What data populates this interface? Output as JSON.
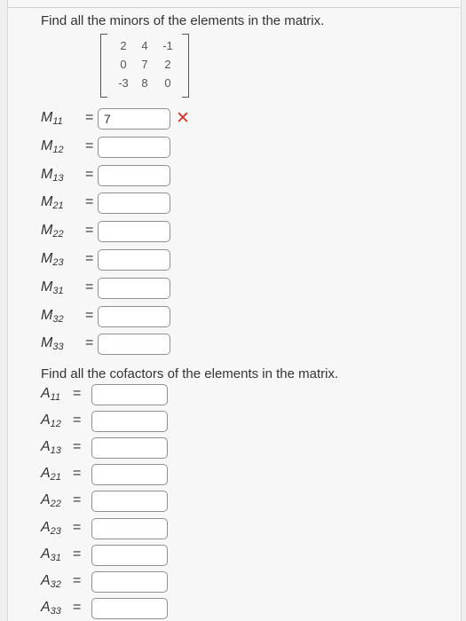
{
  "minors_prompt": "Find all the minors of the elements in the matrix.",
  "cofactors_prompt": "Find all the cofactors of the elements in the matrix.",
  "matrix": [
    [
      "2",
      "4",
      "-1"
    ],
    [
      "0",
      "7",
      "2"
    ],
    [
      "-3",
      "8",
      "0"
    ]
  ],
  "equals": "=",
  "minors": [
    {
      "letter": "M",
      "sub": "11",
      "value": "7",
      "status": "incorrect"
    },
    {
      "letter": "M",
      "sub": "12",
      "value": ""
    },
    {
      "letter": "M",
      "sub": "13",
      "value": ""
    },
    {
      "letter": "M",
      "sub": "21",
      "value": ""
    },
    {
      "letter": "M",
      "sub": "22",
      "value": ""
    },
    {
      "letter": "M",
      "sub": "23",
      "value": ""
    },
    {
      "letter": "M",
      "sub": "31",
      "value": ""
    },
    {
      "letter": "M",
      "sub": "32",
      "value": ""
    },
    {
      "letter": "M",
      "sub": "33",
      "value": ""
    }
  ],
  "cofactors": [
    {
      "letter": "A",
      "sub": "11",
      "value": ""
    },
    {
      "letter": "A",
      "sub": "12",
      "value": ""
    },
    {
      "letter": "A",
      "sub": "13",
      "value": ""
    },
    {
      "letter": "A",
      "sub": "21",
      "value": ""
    },
    {
      "letter": "A",
      "sub": "22",
      "value": ""
    },
    {
      "letter": "A",
      "sub": "23",
      "value": ""
    },
    {
      "letter": "A",
      "sub": "31",
      "value": ""
    },
    {
      "letter": "A",
      "sub": "32",
      "value": ""
    },
    {
      "letter": "A",
      "sub": "33",
      "value": ""
    }
  ],
  "incorrect_mark": "✕",
  "colors": {
    "incorrect": "#d9322b",
    "input_border": "#8f8f8f"
  }
}
